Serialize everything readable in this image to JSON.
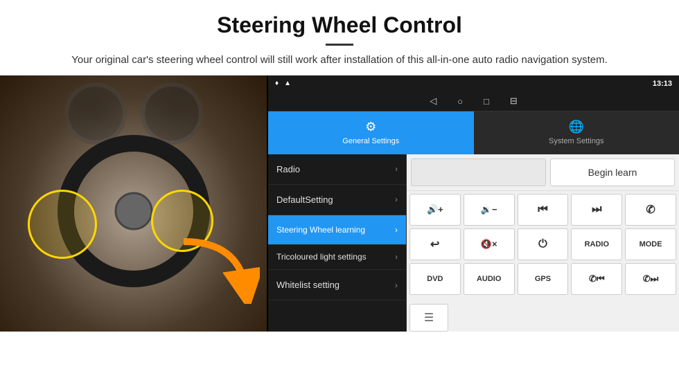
{
  "header": {
    "title": "Steering Wheel Control",
    "subtitle": "Your original car's steering wheel control will still work after installation of this all-in-one auto radio navigation system."
  },
  "statusBar": {
    "time": "13:13",
    "icons": [
      "◁",
      "○",
      "□",
      "⊟"
    ]
  },
  "tabs": [
    {
      "id": "general",
      "label": "General Settings",
      "icon": "⚙",
      "active": true
    },
    {
      "id": "system",
      "label": "System Settings",
      "icon": "🌐",
      "active": false
    }
  ],
  "menu": [
    {
      "id": "radio",
      "label": "Radio",
      "active": false
    },
    {
      "id": "defaultsetting",
      "label": "DefaultSetting",
      "active": false
    },
    {
      "id": "steering",
      "label": "Steering Wheel learning",
      "active": true
    },
    {
      "id": "tricoloured",
      "label": "Tricoloured light settings",
      "active": false
    },
    {
      "id": "whitelist",
      "label": "Whitelist setting",
      "active": false
    }
  ],
  "controls": {
    "begin_learn": "Begin learn",
    "rows": [
      [
        {
          "id": "vol-up",
          "icon": "🔊+",
          "text": "🔊+"
        },
        {
          "id": "vol-down",
          "icon": "🔉-",
          "text": "🔉−"
        },
        {
          "id": "prev-track",
          "icon": "⏮",
          "text": "⏮"
        },
        {
          "id": "next-track",
          "icon": "⏭",
          "text": "⏭"
        },
        {
          "id": "phone",
          "icon": "📞",
          "text": "✆"
        }
      ],
      [
        {
          "id": "hang-up",
          "icon": "↩",
          "text": "↩"
        },
        {
          "id": "mute",
          "icon": "🔇x",
          "text": "🔇×"
        },
        {
          "id": "power",
          "icon": "⏻",
          "text": "⏻"
        },
        {
          "id": "radio-btn",
          "icon": "RADIO",
          "text": "RADIO"
        },
        {
          "id": "mode",
          "icon": "MODE",
          "text": "MODE"
        }
      ],
      [
        {
          "id": "dvd",
          "icon": "DVD",
          "text": "DVD"
        },
        {
          "id": "audio",
          "icon": "AUDIO",
          "text": "AUDIO"
        },
        {
          "id": "gps",
          "icon": "GPS",
          "text": "GPS"
        },
        {
          "id": "tel-prev",
          "icon": "📞⏮",
          "text": "✆⏮"
        },
        {
          "id": "tel-next",
          "icon": "📞⏭",
          "text": "✆⏭"
        }
      ]
    ],
    "whitelist_icon": "☰"
  },
  "colors": {
    "active_tab": "#2196F3",
    "menu_active": "#2196F3",
    "background_dark": "#1a1a1a",
    "background_light": "#f0f0f0"
  }
}
